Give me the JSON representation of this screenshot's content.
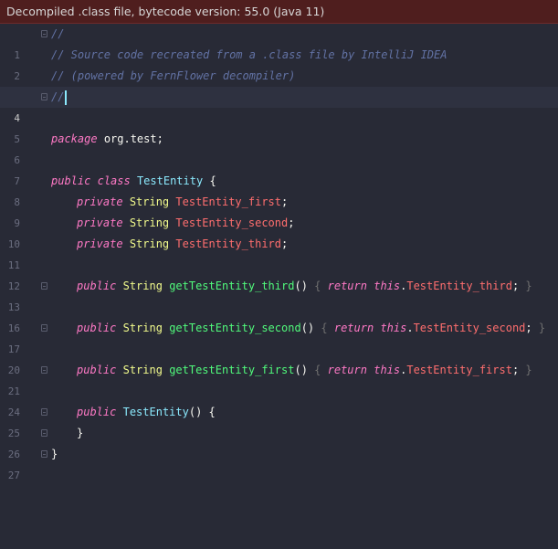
{
  "banner": {
    "text": "Decompiled .class file, bytecode version: 55.0 (Java 11)"
  },
  "colors": {
    "background": "#282a36",
    "banner": "#4f1e1e",
    "comment": "#6272a4",
    "keyword": "#ff79c6",
    "field": "#ff6e6e",
    "method": "#50fa7b",
    "type": "#8be9fd"
  },
  "lines": [
    {
      "num": "1",
      "comment": "//"
    },
    {
      "num": "2",
      "comment": "// Source code recreated from a .class file by IntelliJ IDEA"
    },
    {
      "num": "3",
      "comment": "// (powered by FernFlower decompiler)"
    },
    {
      "num": "4",
      "comment": "//"
    },
    {
      "num": "5"
    },
    {
      "num": "6",
      "kw": "package",
      "text": "org.test;"
    },
    {
      "num": "7"
    },
    {
      "num": "8",
      "kw1": "public",
      "kw2": "class",
      "type": "TestEntity",
      "text": "{"
    },
    {
      "num": "9",
      "kw": "private",
      "type": "String",
      "field": "TestEntity_first",
      "end": ";"
    },
    {
      "num": "10",
      "kw": "private",
      "type": "String",
      "field": "TestEntity_second",
      "end": ";"
    },
    {
      "num": "11",
      "kw": "private",
      "type": "String",
      "field": "TestEntity_third",
      "end": ";"
    },
    {
      "num": "12"
    },
    {
      "num": "13",
      "kw": "public",
      "type": "String",
      "method": "getTestEntity_third",
      "paren": "()",
      "ob": "{",
      "ret": "return",
      "this": "this",
      "dot": ".",
      "field": "TestEntity_third",
      "semi": ";",
      "cb": "}"
    },
    {
      "num": "16"
    },
    {
      "num": "17",
      "kw": "public",
      "type": "String",
      "method": "getTestEntity_second",
      "paren": "()",
      "ob": "{",
      "ret": "return",
      "this": "this",
      "dot": ".",
      "field": "TestEntity_second",
      "semi": ";",
      "cb": "}"
    },
    {
      "num": "20"
    },
    {
      "num": "21",
      "kw": "public",
      "type": "String",
      "method": "getTestEntity_first",
      "paren": "()",
      "ob": "{",
      "ret": "return",
      "this": "this",
      "dot": ".",
      "field": "TestEntity_first",
      "semi": ";",
      "cb": "}"
    },
    {
      "num": "24"
    },
    {
      "num": "25",
      "kw": "public",
      "ctor": "TestEntity",
      "text": "() {"
    },
    {
      "num": "26",
      "text": "}"
    },
    {
      "num": "27",
      "text": "}"
    }
  ]
}
